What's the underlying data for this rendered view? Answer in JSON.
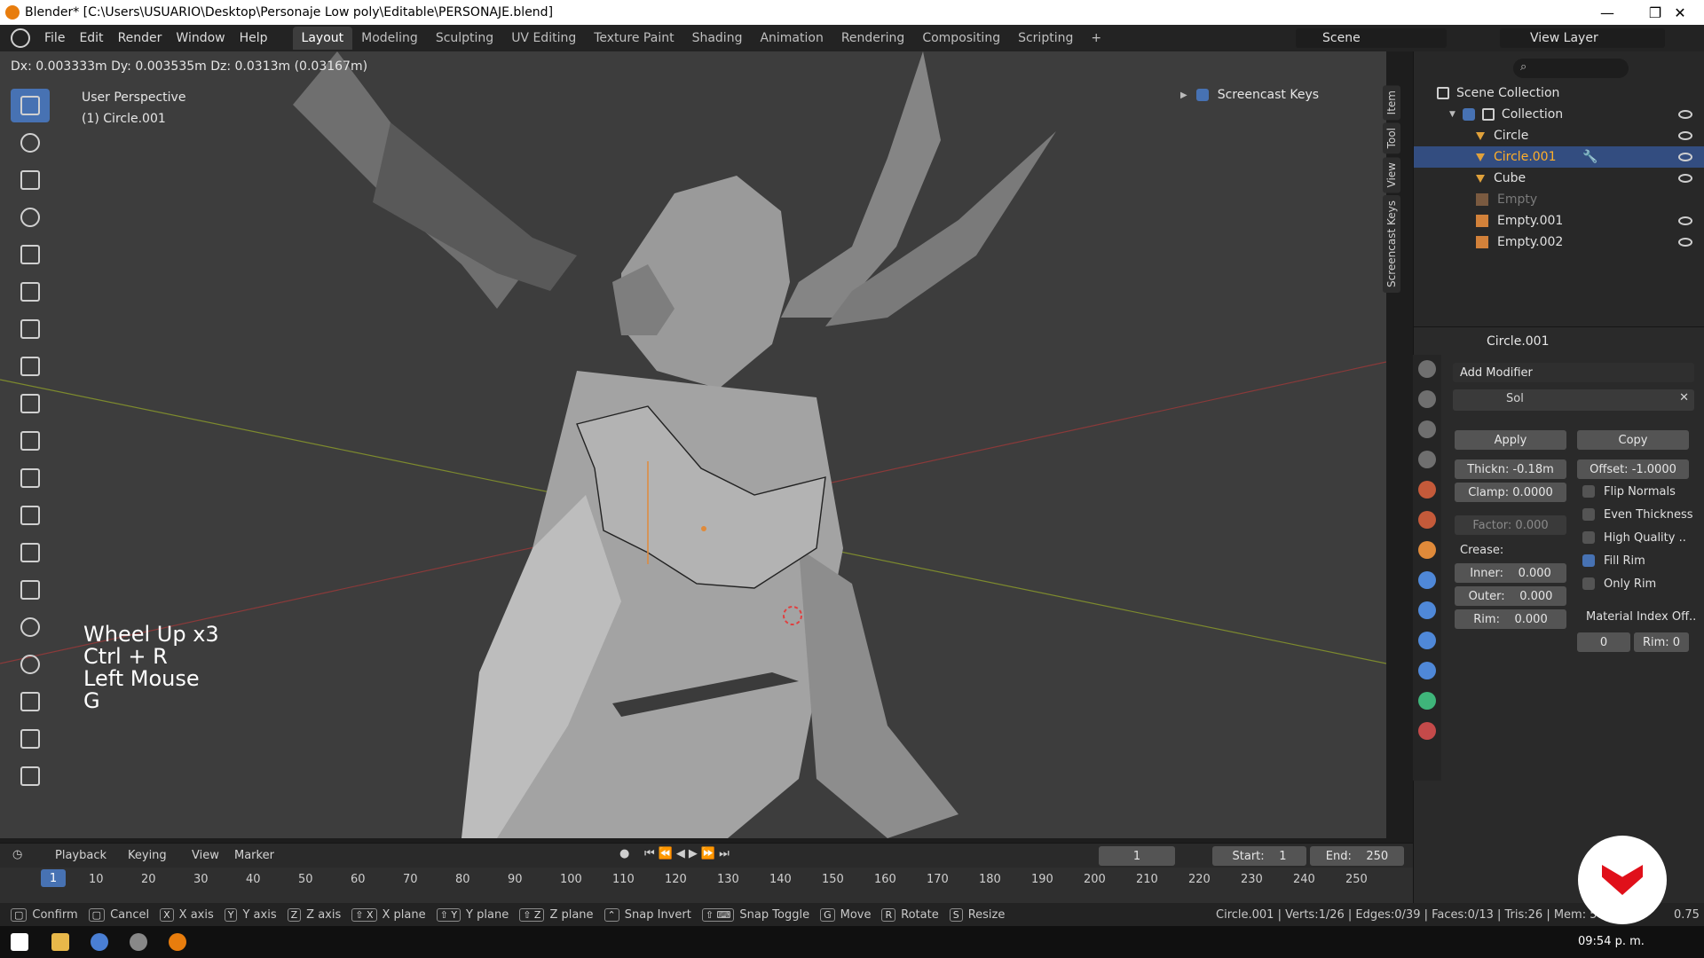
{
  "window": {
    "title": "Blender* [C:\\Users\\USUARIO\\Desktop\\Personaje Low poly\\Editable\\PERSONAJE.blend]"
  },
  "menu": [
    "File",
    "Edit",
    "Render",
    "Window",
    "Help"
  ],
  "workspaces": [
    "Layout",
    "Modeling",
    "Sculpting",
    "UV Editing",
    "Texture Paint",
    "Shading",
    "Animation",
    "Rendering",
    "Compositing",
    "Scripting"
  ],
  "scene": {
    "name": "Scene",
    "view_layer": "View Layer"
  },
  "viewport": {
    "transform_info": "Dx: 0.003333m  Dy: 0.003535m  Dz: 0.0313m (0.03167m)",
    "perspective": "User Perspective",
    "object": "(1) Circle.001",
    "screencast_panel": "Screencast Keys"
  },
  "screencast_keys": [
    "Wheel Up x3",
    "Ctrl + R",
    "Left Mouse",
    "G"
  ],
  "npanel_tabs": [
    "Item",
    "Tool",
    "View",
    "Screencast Keys"
  ],
  "outliner": {
    "root": "Scene Collection",
    "collection": "Collection",
    "items": [
      {
        "name": "Circle",
        "selected": false
      },
      {
        "name": "Circle.001",
        "selected": true
      },
      {
        "name": "Cube",
        "selected": false
      },
      {
        "name": "Empty",
        "selected": false
      },
      {
        "name": "Empty.001",
        "selected": false
      },
      {
        "name": "Empty.002",
        "selected": false
      }
    ]
  },
  "properties": {
    "object_name": "Circle.001",
    "add_modifier": "Add Modifier",
    "modifier_name": "Sol",
    "apply": "Apply",
    "copy": "Copy",
    "thickness": "Thickn: -0.18m",
    "offset": "Offset: -1.0000",
    "clamp": "Clamp: 0.0000",
    "factor": "Factor: 0.000",
    "crease_label": "Crease:",
    "inner": {
      "label": "Inner:",
      "value": "0.000"
    },
    "outer": {
      "label": "Outer:",
      "value": "0.000"
    },
    "rim": {
      "label": "Rim:",
      "value": "0.000"
    },
    "flip_normals": "Flip Normals",
    "even_thickness": "Even Thickness",
    "high_quality": "High Quality ..",
    "fill_rim": "Fill Rim",
    "only_rim": "Only Rim",
    "material_index": "Material Index Off..",
    "mat_index_value": "0",
    "mat_rim": "Rim: 0"
  },
  "timeline": {
    "menus": [
      "Playback",
      "Keying",
      "View",
      "Marker"
    ],
    "current_frame": "1",
    "start": "Start:",
    "start_value": "1",
    "end": "End:",
    "end_value": "250",
    "frames": [
      "10",
      "20",
      "30",
      "40",
      "50",
      "60",
      "70",
      "80",
      "90",
      "100",
      "110",
      "120",
      "130",
      "140",
      "150",
      "160",
      "170",
      "180",
      "190",
      "200",
      "210",
      "220",
      "230",
      "240",
      "250"
    ]
  },
  "statusbar": {
    "items": [
      {
        "key": "",
        "label": "Confirm"
      },
      {
        "key": "",
        "label": "Cancel"
      },
      {
        "key": "X",
        "label": "X axis"
      },
      {
        "key": "Y",
        "label": "Y axis"
      },
      {
        "key": "Z",
        "label": "Z axis"
      },
      {
        "key": "⇧ X",
        "label": "X plane"
      },
      {
        "key": "⇧ Y",
        "label": "Y plane"
      },
      {
        "key": "⇧ Z",
        "label": "Z plane"
      },
      {
        "key": "⌃",
        "label": "Snap Invert"
      },
      {
        "key": "⇧ ⌨",
        "label": "Snap Toggle"
      },
      {
        "key": "G",
        "label": "Move"
      },
      {
        "key": "R",
        "label": "Rotate"
      },
      {
        "key": "S",
        "label": "Resize"
      }
    ],
    "stats": "Circle.001 | Verts:1/26 | Edges:0/39 | Faces:0/13 | Tris:26 | Mem: 58.7",
    "stats_tail": "0.75"
  },
  "taskbar": {
    "time": "09:54 p. m."
  }
}
